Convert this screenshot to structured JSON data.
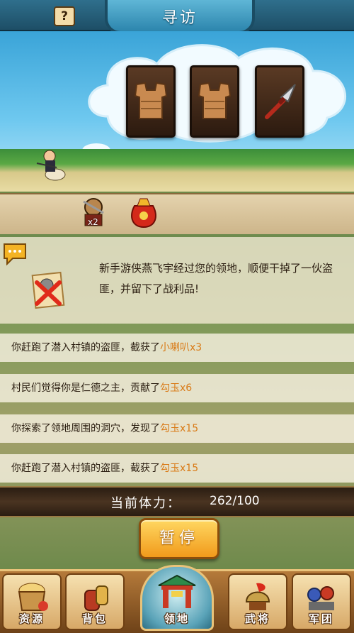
{
  "header": {
    "help_label": "?",
    "title": "寻访"
  },
  "loot_cards": [
    {
      "icon": "leather-armor-icon"
    },
    {
      "icon": "leather-armor-icon"
    },
    {
      "icon": "spear-icon"
    }
  ],
  "rewards": {
    "first": {
      "icon": "bandit-general-icon",
      "count": "x2"
    },
    "second": {
      "icon": "treasure-bag-icon"
    }
  },
  "event": {
    "text": "新手游侠燕飞宇经过您的领地，顺便干掉了一伙盗匪，并留下了战利品!"
  },
  "log": [
    {
      "text": "你赶跑了潜入村镇的盗匪，截获了",
      "item": "小喇叭x3"
    },
    {
      "text": "村民们觉得你是仁德之主，贡献了",
      "item": "勾玉x6"
    },
    {
      "text": "你探索了领地周围的洞穴，发现了",
      "item": "勾玉x15"
    },
    {
      "text": "你赶跑了潜入村镇的盗匪，截获了",
      "item": "勾玉x15"
    }
  ],
  "stamina": {
    "label": "当前体力：",
    "value": "262/100"
  },
  "pause_label": "暂停",
  "nav": [
    {
      "label": "资源",
      "icon": "resource-basket-icon"
    },
    {
      "label": "背包",
      "icon": "backpack-jars-icon"
    },
    {
      "label": "领地",
      "icon": "territory-gate-icon",
      "active": true
    },
    {
      "label": "武将",
      "icon": "general-helmet-icon"
    },
    {
      "label": "军团",
      "icon": "legion-soldiers-icon"
    }
  ],
  "colors": {
    "log_item": "#d97a16",
    "title_plate": "#2c85ad",
    "pause_button": "#f19a1b"
  }
}
